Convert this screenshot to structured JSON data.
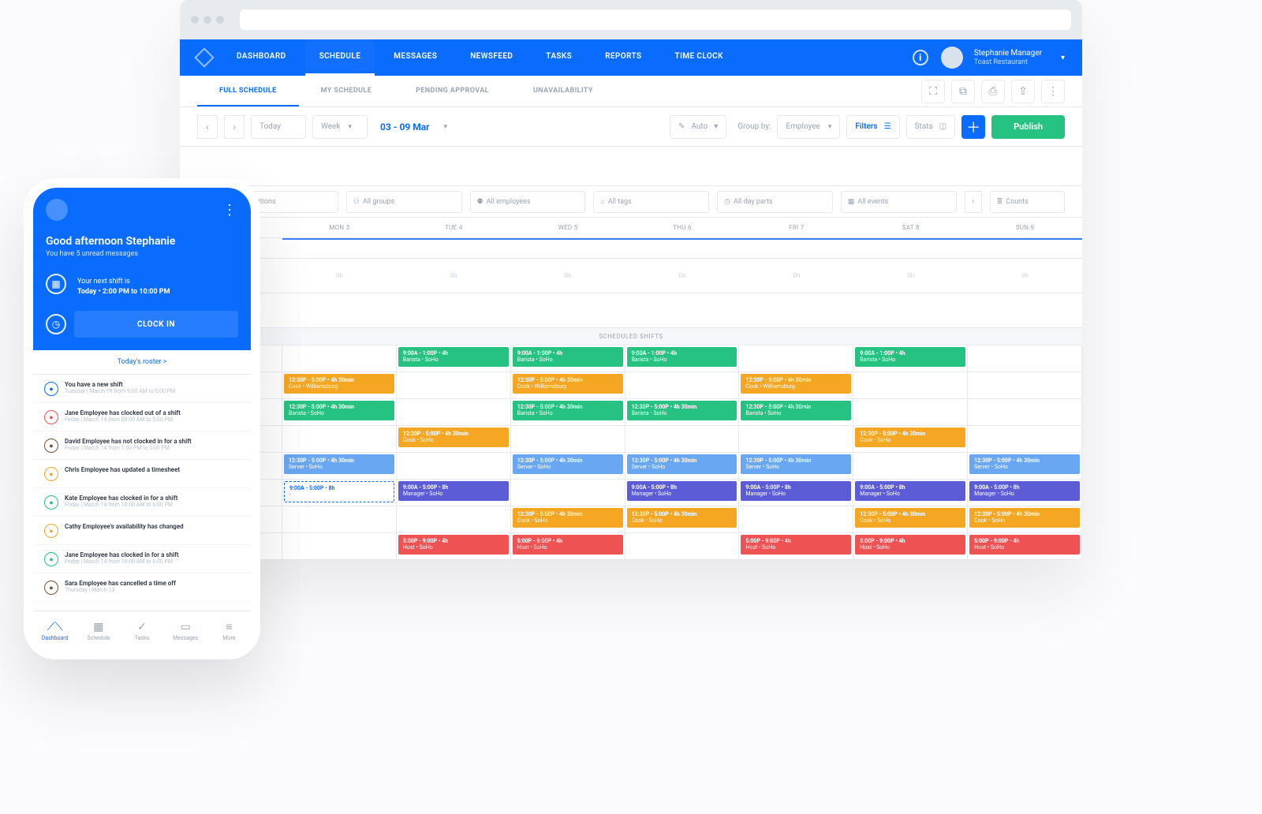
{
  "nav": {
    "items": [
      "DASHBOARD",
      "SCHEDULE",
      "MESSAGES",
      "NEWSFEED",
      "TASKS",
      "REPORTS",
      "TIME CLOCK"
    ],
    "active": 1
  },
  "user": {
    "name": "Stephanie Manager",
    "org": "Toast Restaurant"
  },
  "subtabs": {
    "items": [
      "FULL SCHEDULE",
      "MY SCHEDULE",
      "PENDING APPROVAL",
      "UNAVAILABILITY"
    ],
    "active": 0
  },
  "toolbar": {
    "today": "Today",
    "period": "Week",
    "range": "03 - 09 Mar",
    "auto": "Auto",
    "groupby_label": "Group by:",
    "groupby_value": "Employee",
    "filters": "Filters",
    "stats": "Stats",
    "publish": "Publish"
  },
  "filters": [
    "All positions",
    "All groups",
    "All employees",
    "All tags",
    "All day parts",
    "All events",
    "Counts"
  ],
  "days": [
    "MON 3",
    "TUE 4",
    "WED 5",
    "THU 6",
    "FRI 7",
    "SAT 8",
    "SUN 9"
  ],
  "hours_label": "0h",
  "sections": {
    "scheduled": "SCHEDULED SHIFTS"
  },
  "shifts": {
    "barista_soho": {
      "l1": "9:00A - 1:00P • 4h",
      "l2": "Barista • SoHo"
    },
    "cook_wburg": {
      "l1": "12:30P - 5:00P • 4h 30min",
      "l2": "Cook • Williamsburg"
    },
    "barista_soho2": {
      "l1": "12:30P - 5:00P • 4h 30min",
      "l2": "Barista • SoHo"
    },
    "cook_soho": {
      "l1": "12:30P - 5:00P • 4h 30min",
      "l2": "Cook • SoHo"
    },
    "server_soho": {
      "l1": "12:30P - 5:00P • 4h 30min",
      "l2": "Server • SoHo"
    },
    "manager": {
      "l1": "9:00A - 5:00P • 8h",
      "l2": "Manager • SoHo"
    },
    "ghost": {
      "l1": "9:00A - 5:00P • 8h",
      "l2": "-"
    },
    "host": {
      "l1": "5:00P - 9:00P • 4h",
      "l2": "Host • SoHo"
    }
  },
  "mobile": {
    "greeting": "Good afternoon Stephanie",
    "unread": "You have 5 unread messages",
    "next_shift_lbl": "Your next shift is",
    "next_shift_val": "Today • 2:00 PM to 10:00 PM",
    "clock_in": "CLOCK IN",
    "roster_link": "Today's roster >",
    "feed": [
      {
        "color": "#0a6cff",
        "t1": "You have a new shift",
        "t2": "Tuesday | March 19 from 9:00 AM to 5:00 PM"
      },
      {
        "color": "#ee5253",
        "t1": "Jane Employee has clocked out of a shift",
        "t2": "Friday | March 14 from 09:00 AM to 5:00 PM"
      },
      {
        "color": "#7a5230",
        "t1": "David Employee has not clocked in for a shift",
        "t2": "Friday | March 14 from 1:00 PM to 5:00 PM"
      },
      {
        "color": "#f5a623",
        "t1": "Chris Employee has updated a timesheet",
        "t2": ""
      },
      {
        "color": "#26c281",
        "t1": "Kate Employee has clocked in for a shift",
        "t2": "Friday | March 14 from 10:00 AM to 6:00 PM"
      },
      {
        "color": "#f5a623",
        "t1": "Cathy Employee's availability has changed",
        "t2": ""
      },
      {
        "color": "#26c281",
        "t1": "Jane Employee has clocked in for a shift",
        "t2": "Friday | March 14 from 10:00 AM to 6:00 PM"
      },
      {
        "color": "#7a5230",
        "t1": "Sara Employee has cancelled a time off",
        "t2": "Thursday | March 13"
      }
    ],
    "tabs": [
      "Dashboard",
      "Schedule",
      "Tasks",
      "Messages",
      "More"
    ]
  }
}
